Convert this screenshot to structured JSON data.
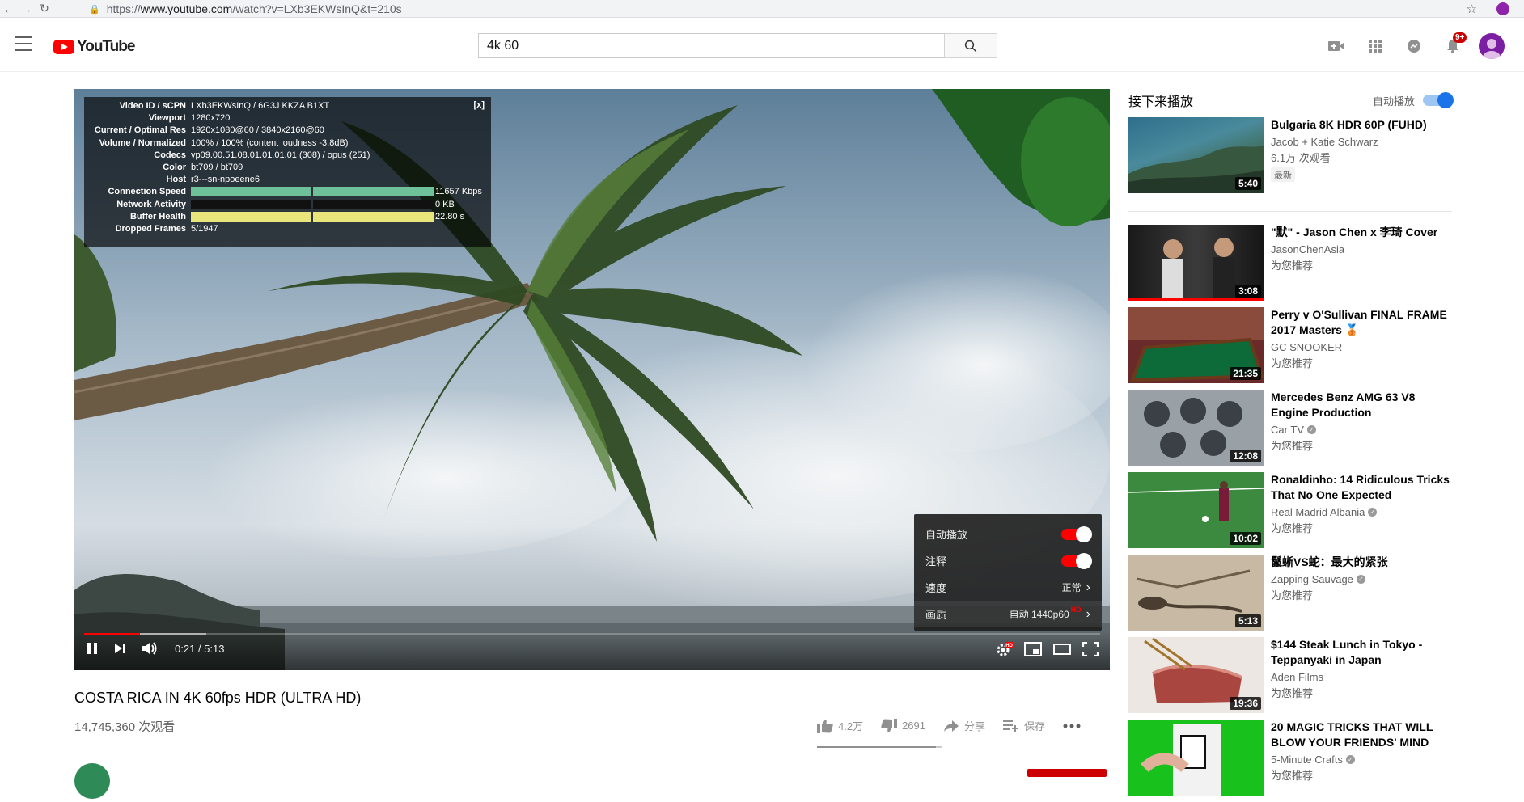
{
  "browser": {
    "url_scheme": "https://",
    "url_host": "www.youtube.com",
    "url_path": "/watch?v=LXb3EKWsInQ&t=210s"
  },
  "masthead": {
    "logo_text": "YouTube",
    "search_value": "4k 60",
    "notification_count": "9+"
  },
  "player": {
    "stats": {
      "close": "[x]",
      "rows": [
        {
          "key": "Video ID / sCPN",
          "value": "LXb3EKWsInQ / 6G3J KKZA B1XT"
        },
        {
          "key": "Viewport",
          "value": "1280x720"
        },
        {
          "key": "Current / Optimal Res",
          "value": "1920x1080@60 / 3840x2160@60"
        },
        {
          "key": "Volume / Normalized",
          "value": "100% / 100% (content loudness -3.8dB)"
        },
        {
          "key": "Codecs",
          "value": "vp09.00.51.08.01.01.01.01 (308) / opus (251)"
        },
        {
          "key": "Color",
          "value": "bt709 / bt709"
        },
        {
          "key": "Host",
          "value": "r3---sn-npoeene6"
        },
        {
          "key": "Connection Speed",
          "value": "11657 Kbps"
        },
        {
          "key": "Network Activity",
          "value": "0 KB"
        },
        {
          "key": "Buffer Health",
          "value": "22.80 s"
        },
        {
          "key": "Dropped Frames",
          "value": "5/1947"
        }
      ]
    },
    "settings": {
      "autoplay_label": "自动播放",
      "annotations_label": "注释",
      "speed_label": "速度",
      "speed_value": "正常",
      "quality_label": "画质",
      "quality_value": "自动 1440p60",
      "quality_badge": "HD"
    },
    "time": "0:21 / 5:13",
    "progress_played": 0.055,
    "progress_loaded": 0.12
  },
  "video": {
    "title": "COSTA RICA IN 4K 60fps HDR (ULTRA HD)",
    "views": "14,745,360 次观看",
    "likes": "4.2万",
    "dislikes": "2691",
    "share": "分享",
    "save": "保存"
  },
  "sidebar": {
    "up_next": "接下来播放",
    "autoplay": "自动播放",
    "items": [
      {
        "title": "Bulgaria 8K HDR 60P (FUHD)",
        "channel": "Jacob + Katie Schwarz",
        "meta": "6.1万 次观看",
        "badge": "最新",
        "duration": "5:40",
        "verified": false
      },
      {
        "title": "\"默\" - Jason Chen x 李琦 Cover",
        "channel": "JasonChenAsia",
        "meta": "为您推荐",
        "duration": "3:08",
        "verified": false
      },
      {
        "title": "Perry v O'Sullivan FINAL FRAME 2017 Masters 🥉",
        "channel": "GC SNOOKER",
        "meta": "为您推荐",
        "duration": "21:35",
        "verified": false
      },
      {
        "title": "Mercedes Benz AMG 63 V8 Engine Production",
        "channel": "Car TV",
        "meta": "为您推荐",
        "duration": "12:08",
        "verified": true
      },
      {
        "title": "Ronaldinho: 14 Ridiculous Tricks That No One Expected",
        "channel": "Real Madrid Albania",
        "meta": "为您推荐",
        "duration": "10:02",
        "verified": true
      },
      {
        "title": "鬣蜥VS蛇：最大的紧张",
        "channel": "Zapping Sauvage",
        "meta": "为您推荐",
        "duration": "5:13",
        "verified": true
      },
      {
        "title": "$144 Steak Lunch in Tokyo - Teppanyaki in Japan",
        "channel": "Aden Films",
        "meta": "为您推荐",
        "duration": "19:36",
        "verified": false
      },
      {
        "title": "20 MAGIC TRICKS THAT WILL BLOW YOUR FRIENDS' MIND",
        "channel": "5-Minute Crafts",
        "meta": "为您推荐",
        "duration": "",
        "verified": true
      }
    ]
  }
}
